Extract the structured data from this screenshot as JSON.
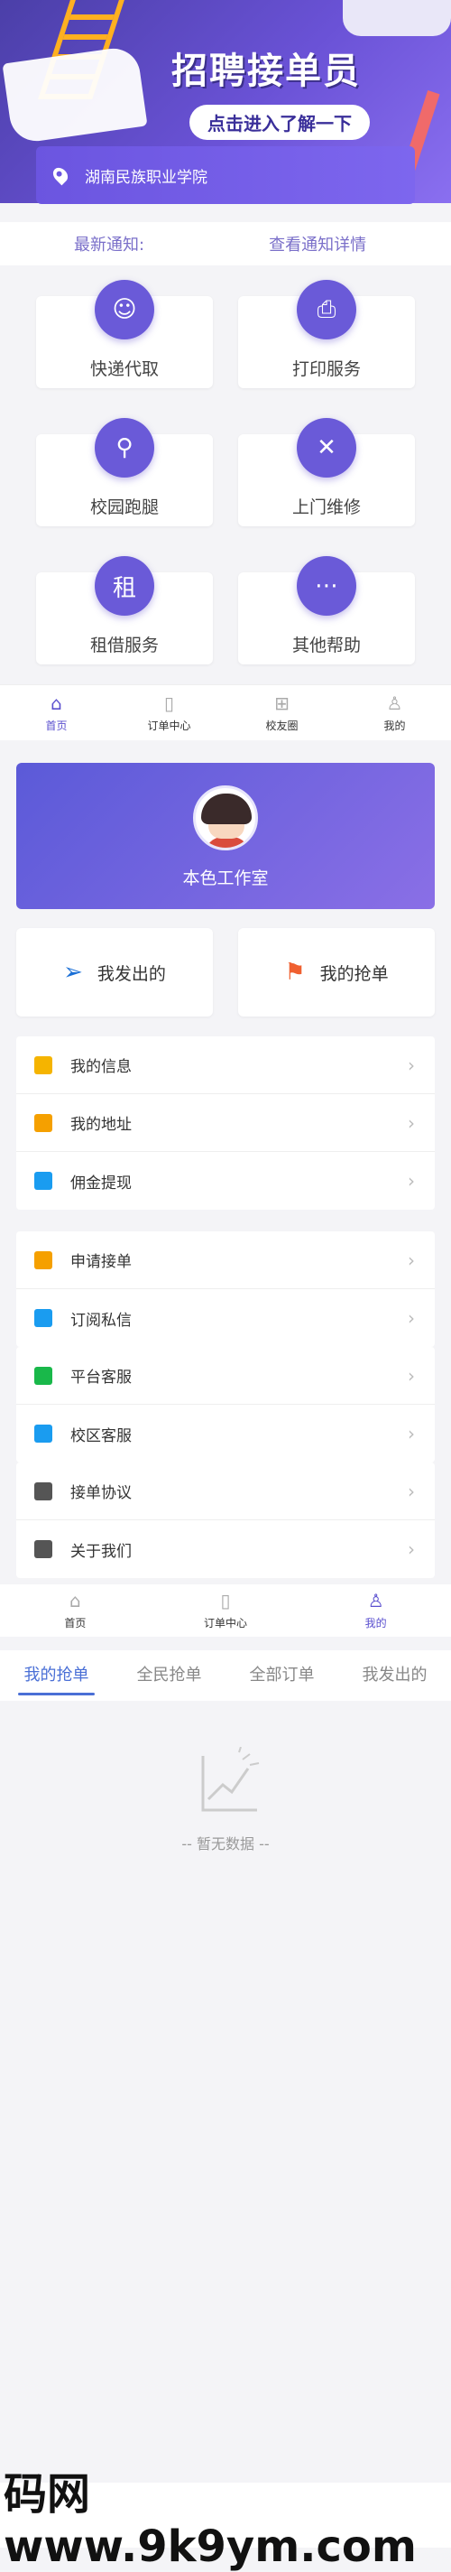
{
  "banner": {
    "title": "招聘接单员",
    "subtitle": "点击进入了解一下"
  },
  "location": {
    "school": "湖南民族职业学院"
  },
  "notice": {
    "label": "最新通知:",
    "link": "查看通知详情"
  },
  "services": [
    {
      "label": "快递代取",
      "icon": "delivery-person-icon",
      "glyph": "☺"
    },
    {
      "label": "打印服务",
      "icon": "printer-icon",
      "glyph": "⎙"
    },
    {
      "label": "校园跑腿",
      "icon": "scooter-icon",
      "glyph": "⚲"
    },
    {
      "label": "上门维修",
      "icon": "wrench-icon",
      "glyph": "✕"
    },
    {
      "label": "租借服务",
      "icon": "rent-icon",
      "glyph": "租"
    },
    {
      "label": "其他帮助",
      "icon": "more-icon",
      "glyph": "⋯"
    }
  ],
  "tabbar1": [
    {
      "label": "首页",
      "icon": "home-icon",
      "glyph": "⌂",
      "active": true
    },
    {
      "label": "订单中心",
      "icon": "order-icon",
      "glyph": "▯",
      "active": false
    },
    {
      "label": "校友圈",
      "icon": "store-icon",
      "glyph": "⊞",
      "active": false
    },
    {
      "label": "我的",
      "icon": "user-icon",
      "glyph": "♙",
      "active": false
    }
  ],
  "profile": {
    "name": "本色工作室"
  },
  "actions": {
    "sent": "我发出的",
    "grab": "我的抢单"
  },
  "list_groups": [
    [
      {
        "label": "我的信息",
        "icon": "info-card-icon",
        "color": "#f5b400"
      },
      {
        "label": "我的地址",
        "icon": "location-pin-icon",
        "color": "#f5a000"
      },
      {
        "label": "佣金提现",
        "icon": "card-icon",
        "color": "#1a9cf0"
      }
    ],
    [
      {
        "label": "申请接单",
        "icon": "apply-icon",
        "color": "#f5a000"
      },
      {
        "label": "订阅私信",
        "icon": "bell-icon",
        "color": "#1a9cf0"
      }
    ],
    [
      {
        "label": "平台客服",
        "icon": "wechat-icon",
        "color": "#19b84a"
      },
      {
        "label": "校区客服",
        "icon": "headset-icon",
        "color": "#1a9cf0"
      }
    ],
    [
      {
        "label": "接单协议",
        "icon": "document-icon",
        "color": "#555555"
      },
      {
        "label": "关于我们",
        "icon": "about-icon",
        "color": "#555555"
      }
    ]
  ],
  "tabbar2": [
    {
      "label": "首页",
      "icon": "home-icon",
      "glyph": "⌂",
      "active": false
    },
    {
      "label": "订单中心",
      "icon": "order-icon",
      "glyph": "▯",
      "active": false
    },
    {
      "label": "我的",
      "icon": "user-icon",
      "glyph": "♙",
      "active": true
    }
  ],
  "order_tabs": [
    "我的抢单",
    "全民抢单",
    "全部订单",
    "我发出的"
  ],
  "empty": {
    "text": "-- 暂无数据 --"
  },
  "watermark": {
    "text": "码网 www.9k9ym.com"
  },
  "colors": {
    "accent": "#6a5ad8",
    "tab_active": "#4a6fd6"
  }
}
